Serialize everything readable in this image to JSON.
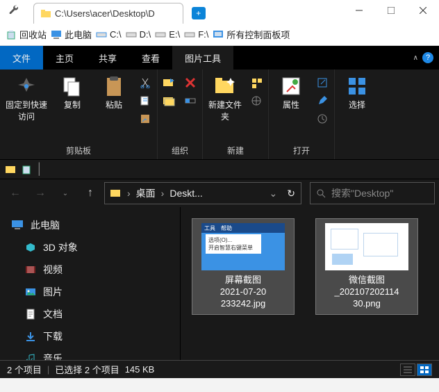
{
  "titlebar": {
    "tab_title": "C:\\Users\\acer\\Desktop\\D",
    "newtab": "+"
  },
  "quickaccess": {
    "items": [
      {
        "label": "回收站"
      },
      {
        "label": "此电脑"
      },
      {
        "label": "C:\\"
      },
      {
        "label": "D:\\"
      },
      {
        "label": "E:\\"
      },
      {
        "label": "F:\\"
      },
      {
        "label": "所有控制面板项"
      }
    ]
  },
  "ribbon_tabs": {
    "file": "文件",
    "home": "主页",
    "share": "共享",
    "view": "查看",
    "picture_tools": "图片工具"
  },
  "ribbon": {
    "clipboard": {
      "pin": "固定到快速访问",
      "copy": "复制",
      "paste": "粘贴",
      "group_label": "剪贴板"
    },
    "organize": {
      "group_label": "组织"
    },
    "new": {
      "new_folder": "新建文件夹",
      "group_label": "新建"
    },
    "open": {
      "properties": "属性",
      "group_label": "打开"
    },
    "select": {
      "select": "选择",
      "group_label": ""
    }
  },
  "nav": {
    "crumbs": [
      "桌面",
      "Deskt..."
    ]
  },
  "search": {
    "placeholder": "搜索\"Desktop\""
  },
  "sidebar": {
    "header": "此电脑",
    "items": [
      "3D 对象",
      "视频",
      "图片",
      "文档",
      "下载",
      "音乐"
    ]
  },
  "files": [
    {
      "name_l1": "屏幕截图",
      "name_l2": "2021-07-20",
      "name_l3": "233242.jpg",
      "thumb_ctx_l1": "选项(O)...",
      "thumb_ctx_l2": "开启智慧右键菜单",
      "thumb_m1": "工具",
      "thumb_m2": "帮助"
    },
    {
      "name_l1": "微信截图",
      "name_l2": "_202107202114",
      "name_l3": "30.png"
    }
  ],
  "statusbar": {
    "items_count": "2 个项目",
    "selected": "已选择 2 个项目",
    "size": "145 KB"
  }
}
